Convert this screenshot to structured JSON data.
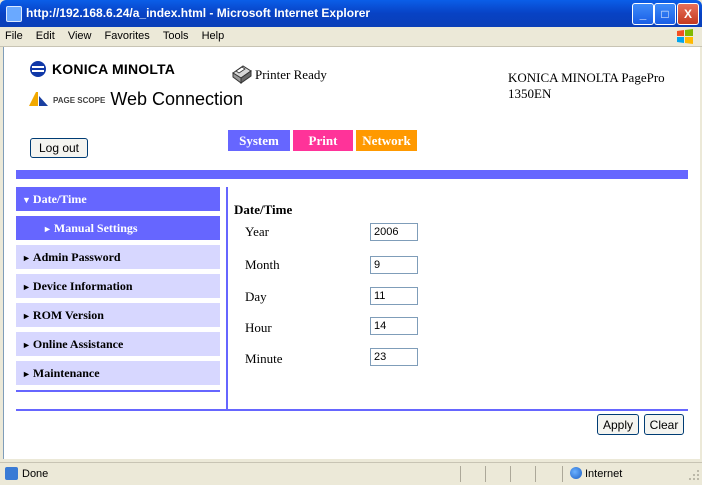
{
  "window": {
    "title": "http://192.168.6.24/a_index.html - Microsoft Internet Explorer",
    "controls": {
      "minimize": "_",
      "maximize": "□",
      "close": "X"
    }
  },
  "menubar": {
    "items": [
      "File",
      "Edit",
      "View",
      "Favorites",
      "Tools",
      "Help"
    ]
  },
  "header": {
    "brand": "KONICA MINOLTA",
    "pagescope_small": "PAGE SCOPE",
    "pagescope_label": "Web Connection",
    "printer_status": "Printer Ready",
    "model_line1": "KONICA MINOLTA PagePro",
    "model_line2": "1350EN",
    "logout_label": "Log out"
  },
  "tabs": {
    "system": "System",
    "print": "Print",
    "network": "Network"
  },
  "sidebar": {
    "items": [
      {
        "label": "Date/Time",
        "state": "expanded"
      },
      {
        "label": "Manual Settings",
        "state": "selected-sub"
      },
      {
        "label": "Admin Password",
        "state": "collapsed"
      },
      {
        "label": "Device Information",
        "state": "collapsed"
      },
      {
        "label": "ROM Version",
        "state": "collapsed"
      },
      {
        "label": "Online Assistance",
        "state": "collapsed"
      },
      {
        "label": "Maintenance",
        "state": "collapsed"
      }
    ]
  },
  "form": {
    "title": "Date/Time",
    "fields": [
      {
        "label": "Year",
        "value": "2006"
      },
      {
        "label": "Month",
        "value": "9"
      },
      {
        "label": "Day",
        "value": "11"
      },
      {
        "label": "Hour",
        "value": "14"
      },
      {
        "label": "Minute",
        "value": "23"
      }
    ],
    "apply_label": "Apply",
    "clear_label": "Clear"
  },
  "statusbar": {
    "status": "Done",
    "zone": "Internet"
  },
  "colors": {
    "accent_blue": "#6666ff",
    "print_tab": "#ff3399",
    "network_tab": "#ff9900",
    "sidebar_bg": "#d7d7ff"
  },
  "icons": {
    "printer": "printer-icon",
    "globe": "globe-icon",
    "windows_logo": "windows-flag-icon"
  }
}
